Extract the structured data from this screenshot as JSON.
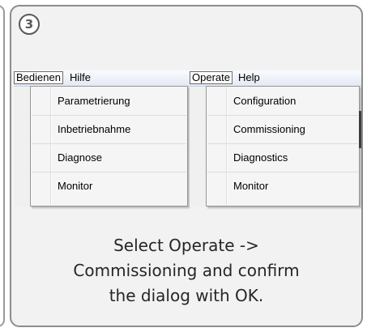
{
  "step": {
    "number": "3"
  },
  "german": {
    "menubar": [
      "Bedienen",
      "Hilfe"
    ],
    "items": [
      "Parametrierung",
      "Inbetriebnahme",
      "Diagnose",
      "Monitor"
    ]
  },
  "english": {
    "menubar": [
      "Operate",
      "Help"
    ],
    "items": [
      "Configuration",
      "Commissioning",
      "Diagnostics",
      "Monitor"
    ]
  },
  "instruction": {
    "lines": [
      "Select Operate ->",
      "Commissioning and confirm",
      "the dialog with OK."
    ]
  },
  "colors": {
    "card_border": "#8c8c8c",
    "card_background": "#f2f2f2",
    "menu_background": "#f5f5f5",
    "text": "#262626"
  }
}
